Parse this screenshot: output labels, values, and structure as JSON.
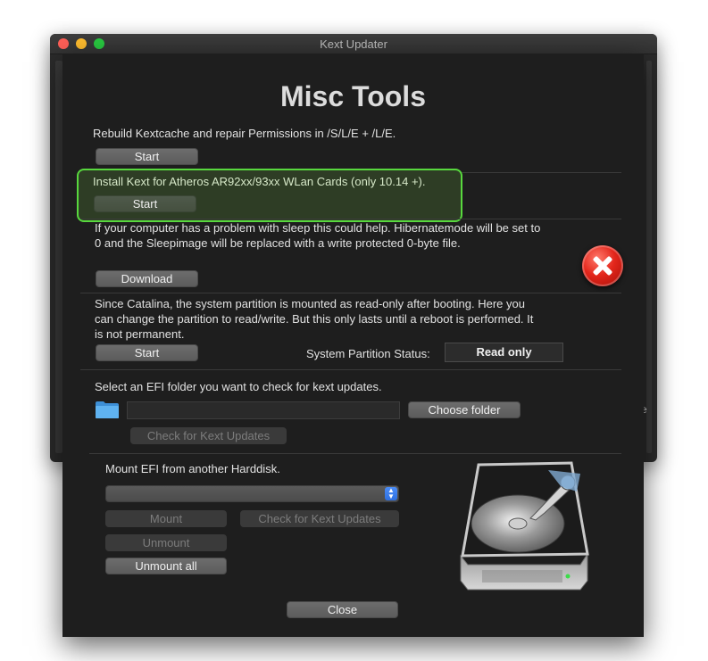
{
  "window": {
    "title": "Kext Updater",
    "partial_text_right": "e"
  },
  "sheet": {
    "title": "Misc Tools",
    "sections": {
      "rebuild": {
        "description": "Rebuild Kextcache and repair Permissions in /S/L/E + /L/E.",
        "button": "Start"
      },
      "atheros": {
        "description": "Install Kext for Atheros AR92xx/93xx WLan Cards (only 10.14 +).",
        "button": "Start"
      },
      "sleep": {
        "line1": "If your computer has a problem with sleep this could help. Hibernatemode will be set to",
        "line2": "0 and the Sleepimage will be replaced with a write protected 0-byte file.",
        "button": "Download"
      },
      "catalina": {
        "line1": "Since Catalina, the system partition is mounted as read-only after booting. Here you",
        "line2": "can change the partition to read/write. But this only lasts until a reboot is performed. It",
        "line3": "is not permanent.",
        "button": "Start",
        "status_label": "System Partition Status:",
        "status_value": "Read only"
      },
      "efi": {
        "description": "Select an EFI folder you want to check for kext updates.",
        "path_value": "",
        "choose_button": "Choose folder",
        "check_button": "Check for Kext Updates"
      },
      "mount": {
        "description": "Mount EFI from another Harddisk.",
        "dropdown_value": "",
        "mount_button": "Mount",
        "check_button": "Check for Kext Updates",
        "unmount_button": "Unmount",
        "unmount_all_button": "Unmount all"
      }
    },
    "close_button": "Close"
  },
  "icons": {
    "error": "error-x-icon",
    "folder": "folder-icon",
    "harddisk": "harddisk-icon"
  },
  "colors": {
    "highlight_border": "#58d83e",
    "error_red": "#e3261b",
    "dropdown_accent": "#2e6fe0"
  }
}
